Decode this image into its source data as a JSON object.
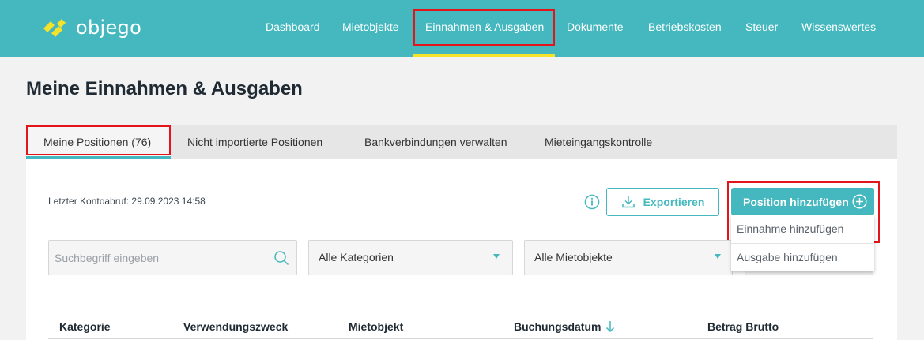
{
  "brand": {
    "name": "objego",
    "primary_color": "#44b8be",
    "accent_color": "#f5e22a",
    "highlight_color": "#e3141a"
  },
  "nav": {
    "items": [
      {
        "label": "Dashboard"
      },
      {
        "label": "Mietobjekte"
      },
      {
        "label": "Einnahmen & Ausgaben",
        "active": true
      },
      {
        "label": "Dokumente"
      },
      {
        "label": "Betriebskosten"
      },
      {
        "label": "Steuer"
      },
      {
        "label": "Wissenswertes"
      }
    ]
  },
  "page": {
    "title": "Meine Einnahmen & Ausgaben"
  },
  "tabs": [
    {
      "label": "Meine Positionen (76)",
      "active": true
    },
    {
      "label": "Nicht importierte Positionen"
    },
    {
      "label": "Bankverbindungen verwalten"
    },
    {
      "label": "Mieteingangskontrolle"
    }
  ],
  "toolbar": {
    "last_fetch": "Letzter Kontoabruf: 29.09.2023 14:58",
    "info_icon": "info-circle-icon",
    "export_label": "Exportieren",
    "export_icon": "download-icon",
    "add_label": "Position hinzufügen",
    "add_icon": "plus-circle-icon",
    "add_menu": [
      {
        "label": "Einnahme hinzufügen"
      },
      {
        "label": "Ausgabe hinzufügen"
      }
    ]
  },
  "filters": {
    "search_placeholder": "Suchbegriff eingeben",
    "search_icon": "search-icon",
    "category": "Alle Kategorien",
    "property": "Alle Mietobjekte"
  },
  "table": {
    "columns": [
      {
        "label": "Kategorie"
      },
      {
        "label": "Verwendungszweck"
      },
      {
        "label": "Mietobjekt"
      },
      {
        "label": "Buchungsdatum",
        "sorted": "desc"
      },
      {
        "label": "Betrag Brutto"
      }
    ]
  }
}
